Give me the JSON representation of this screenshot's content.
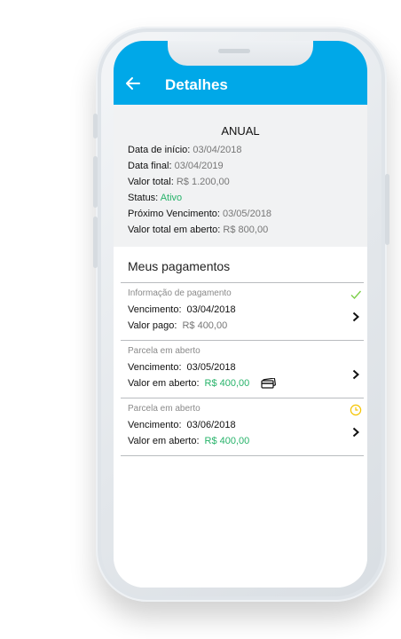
{
  "appbar": {
    "title": "Detalhes"
  },
  "summary": {
    "plan": "ANUAL",
    "start_label": "Data de início:",
    "start_value": "03/04/2018",
    "end_label": "Data final:",
    "end_value": "03/04/2019",
    "total_label": "Valor total:",
    "total_value": "R$ 1.200,00",
    "status_label": "Status:",
    "status_value": "Ativo",
    "next_label": "Próximo Vencimento:",
    "next_value": "03/05/2018",
    "open_label": "Valor total em aberto:",
    "open_value": "R$ 800,00"
  },
  "payments": {
    "title": "Meus pagamentos",
    "items": [
      {
        "caption": "Informação de pagamento",
        "due_label": "Vencimento:",
        "due_value": "03/04/2018",
        "amount_label": "Valor pago:",
        "amount_value": "R$ 400,00",
        "status": "paid",
        "status_icon": "check-icon"
      },
      {
        "caption": "Parcela em aberto",
        "due_label": "Vencimento:",
        "due_value": "03/05/2018",
        "amount_label": "Valor em aberto:",
        "amount_value": "R$ 400,00",
        "status": "open",
        "extra_icon": "credit-card-icon"
      },
      {
        "caption": "Parcela em aberto",
        "due_label": "Vencimento:",
        "due_value": "03/06/2018",
        "amount_label": "Valor em aberto:",
        "amount_value": "R$ 400,00",
        "status": "pending",
        "status_icon": "clock-icon"
      }
    ]
  },
  "colors": {
    "accent": "#00a8e8",
    "green": "#27b36a",
    "pending": "#f5c400"
  }
}
